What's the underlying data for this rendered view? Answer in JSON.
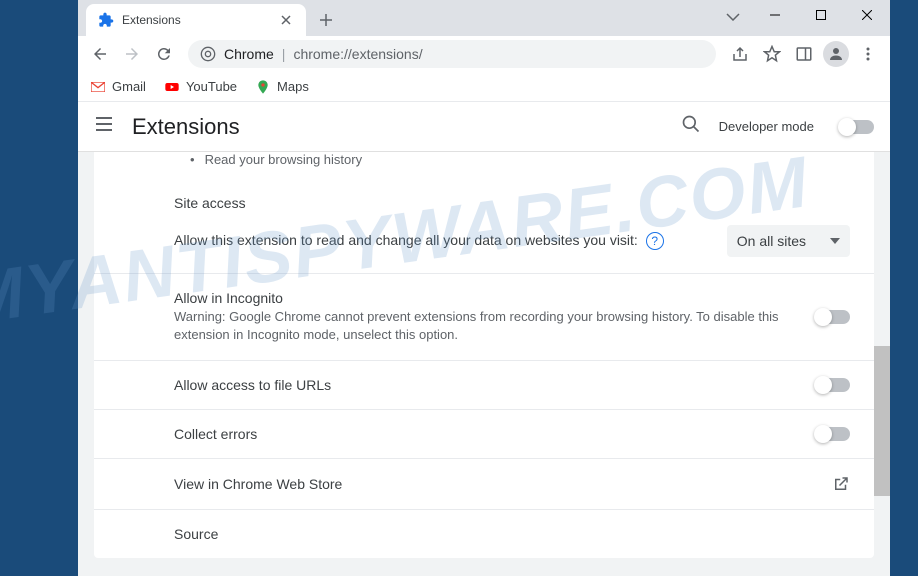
{
  "tab": {
    "title": "Extensions"
  },
  "omnibox": {
    "scheme": "Chrome",
    "path": "chrome://extensions/"
  },
  "bookmarks": [
    {
      "label": "Gmail"
    },
    {
      "label": "YouTube"
    },
    {
      "label": "Maps"
    }
  ],
  "header": {
    "title": "Extensions",
    "dev_mode_label": "Developer mode"
  },
  "content": {
    "browsing_history": "Read your browsing history",
    "site_access_title": "Site access",
    "site_access_desc": "Allow this extension to read and change all your data on websites you visit:",
    "site_access_value": "On all sites",
    "incognito_label": "Allow in Incognito",
    "incognito_desc": "Warning: Google Chrome cannot prevent extensions from recording your browsing history. To disable this extension in Incognito mode, unselect this option.",
    "file_urls_label": "Allow access to file URLs",
    "collect_errors_label": "Collect errors",
    "webstore_label": "View in Chrome Web Store",
    "source_label": "Source"
  },
  "watermark": "MYANTISPYWARE.COM"
}
